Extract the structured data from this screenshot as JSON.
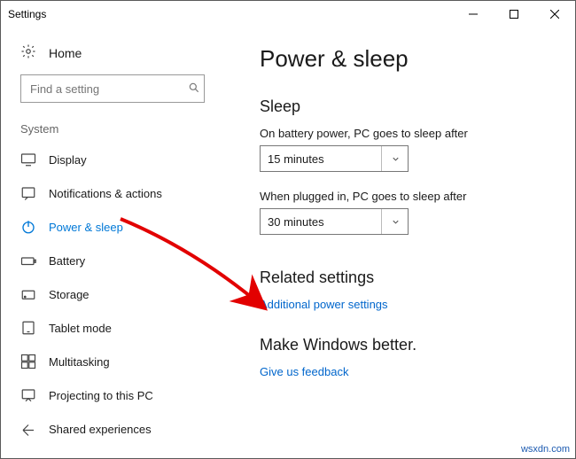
{
  "window": {
    "title": "Settings"
  },
  "home": {
    "label": "Home"
  },
  "search": {
    "placeholder": "Find a setting"
  },
  "group_label": "System",
  "nav": [
    {
      "key": "display",
      "label": "Display"
    },
    {
      "key": "notifications",
      "label": "Notifications & actions"
    },
    {
      "key": "power",
      "label": "Power & sleep",
      "active": true
    },
    {
      "key": "battery",
      "label": "Battery"
    },
    {
      "key": "storage",
      "label": "Storage"
    },
    {
      "key": "tablet",
      "label": "Tablet mode"
    },
    {
      "key": "multitasking",
      "label": "Multitasking"
    },
    {
      "key": "projecting",
      "label": "Projecting to this PC"
    },
    {
      "key": "shared",
      "label": "Shared experiences"
    }
  ],
  "main": {
    "title": "Power & sleep",
    "sleep_heading": "Sleep",
    "battery_label": "On battery power, PC goes to sleep after",
    "battery_value": "15 minutes",
    "plugged_label": "When plugged in, PC goes to sleep after",
    "plugged_value": "30 minutes",
    "related_heading": "Related settings",
    "related_link": "Additional power settings",
    "better_heading": "Make Windows better.",
    "feedback_link": "Give us feedback"
  },
  "watermark": "wsxdn.com"
}
